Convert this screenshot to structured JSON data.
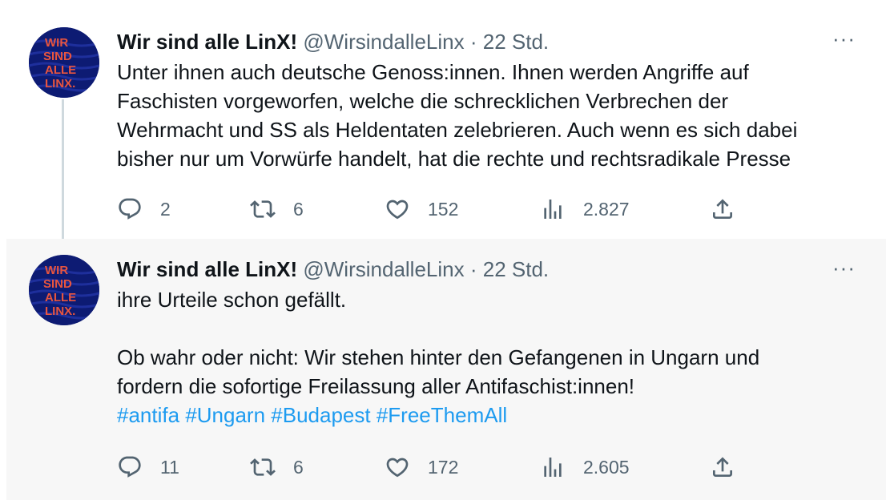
{
  "tweets": [
    {
      "author_name": "Wir sind alle LinX!",
      "handle": "@WirsindalleLinx",
      "separator": "·",
      "time": "22 Std.",
      "more": "···",
      "text_lines": [
        "Unter ihnen auch deutsche Genoss:innen. Ihnen werden Angriffe auf",
        "Faschisten vorgeworfen, welche die schrecklichen Verbrechen der",
        "Wehrmacht und SS als Heldentaten zelebrieren. Auch wenn es sich dabei",
        "bisher nur um Vorwürfe handelt, hat die rechte und rechtsradikale Presse"
      ],
      "stats": {
        "replies": "2",
        "retweets": "6",
        "likes": "152",
        "views": "2.827"
      }
    },
    {
      "author_name": "Wir sind alle LinX!",
      "handle": "@WirsindalleLinx",
      "separator": "·",
      "time": "22 Std.",
      "more": "···",
      "text_line1": "ihre Urteile schon gefällt.",
      "text_line2": "Ob wahr oder nicht: Wir stehen hinter den Gefangenen in Ungarn und",
      "text_line3": "fordern die sofortige Freilassung aller Antifaschist:innen!",
      "hashtags": [
        "#antifa",
        "#Ungarn",
        "#Budapest",
        "#FreeThemAll"
      ],
      "stats": {
        "replies": "11",
        "retweets": "6",
        "likes": "172",
        "views": "2.605"
      }
    }
  ],
  "avatar_text": [
    "WIR",
    "SIND",
    "ALLE",
    "LINX."
  ],
  "colors": {
    "link": "#1d9bf0",
    "secondary_text": "#536471",
    "avatar_bg": "#0d1b73",
    "avatar_text": "#e8553f"
  },
  "icons": [
    "reply-icon",
    "retweet-icon",
    "like-icon",
    "views-icon",
    "share-icon",
    "more-icon"
  ]
}
